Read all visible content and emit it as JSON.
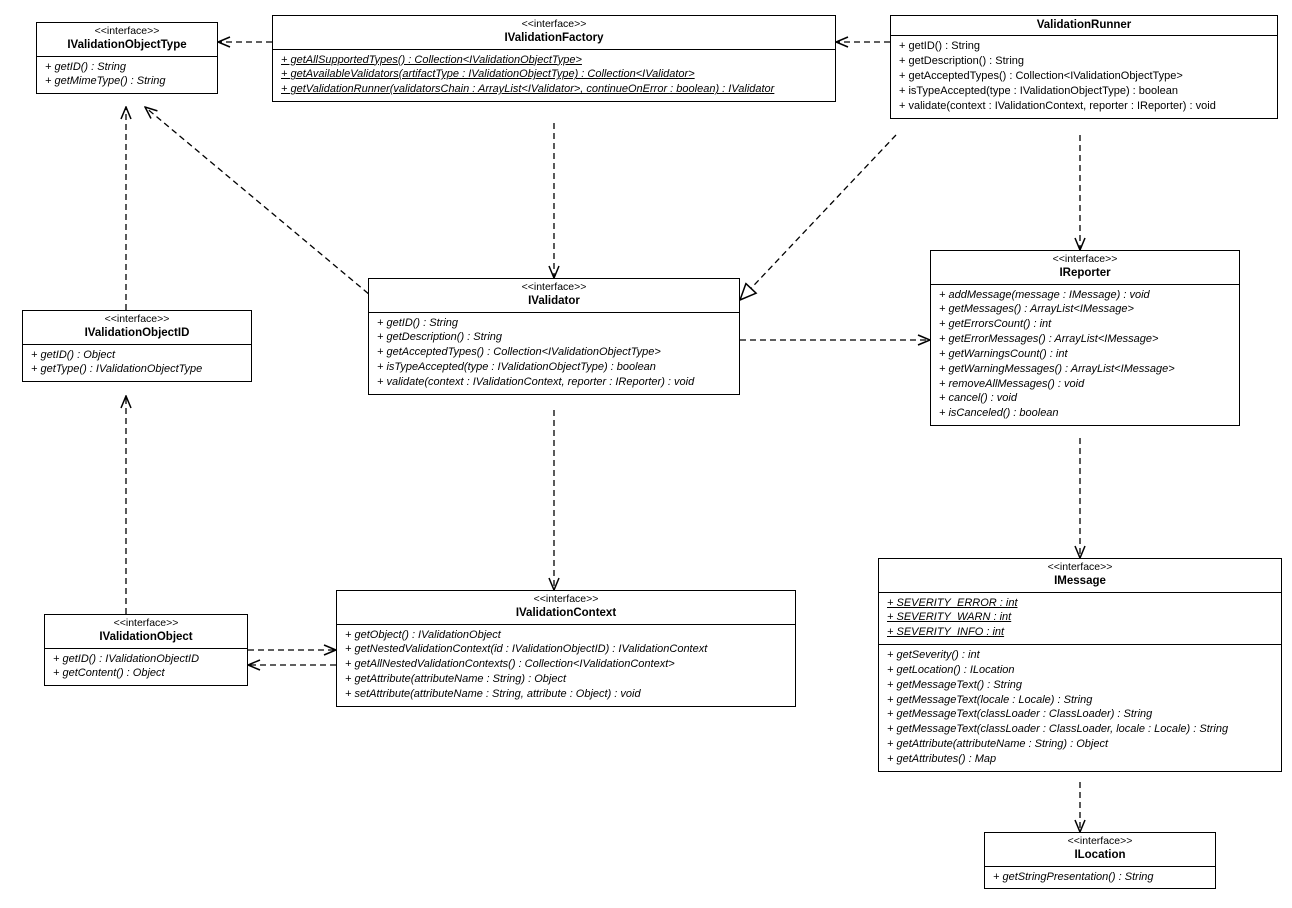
{
  "iValidationObjectType": {
    "stereo": "<<interface>>",
    "name": "IValidationObjectType",
    "ops": [
      "+ getID() : String",
      "+ getMimeType() : String"
    ]
  },
  "iValidationFactory": {
    "stereo": "<<interface>>",
    "name": "IValidationFactory",
    "ops": [
      "+ getAllSupportedTypes() : Collection<IValidationObjectType>",
      "+ getAvailableValidators(artifactType : IValidationObjectType) : Collection<IValidator>",
      "+ getValidationRunner(validatorsChain : ArrayList<IValidator>, continueOnError : boolean) : IValidator"
    ],
    "staticOps": true
  },
  "validationRunner": {
    "name": "ValidationRunner",
    "ops": [
      "+ getID() : String",
      "+ getDescription() : String",
      "+ getAcceptedTypes() : Collection<IValidationObjectType>",
      "+ isTypeAccepted(type : IValidationObjectType) : boolean",
      "+ validate(context : IValidationContext, reporter : IReporter) : void"
    ]
  },
  "iValidationObjectID": {
    "stereo": "<<interface>>",
    "name": "IValidationObjectID",
    "ops": [
      "+ getID() : Object",
      "+ getType() : IValidationObjectType"
    ]
  },
  "iValidator": {
    "stereo": "<<interface>>",
    "name": "IValidator",
    "ops": [
      "+ getID() : String",
      "+ getDescription() : String",
      "+ getAcceptedTypes() : Collection<IValidationObjectType>",
      "+ isTypeAccepted(type : IValidationObjectType) : boolean",
      "+ validate(context : IValidationContext, reporter : IReporter) : void"
    ]
  },
  "iReporter": {
    "stereo": "<<interface>>",
    "name": "IReporter",
    "ops": [
      "+ addMessage(message : IMessage) : void",
      "+ getMessages() : ArrayList<IMessage>",
      "+ getErrorsCount() : int",
      "+ getErrorMessages() : ArrayList<IMessage>",
      "+ getWarningsCount() : int",
      "+ getWarningMessages() : ArrayList<IMessage>",
      "+ removeAllMessages() : void",
      "+ cancel() : void",
      "+ isCanceled() : boolean"
    ]
  },
  "iValidationObject": {
    "stereo": "<<interface>>",
    "name": "IValidationObject",
    "ops": [
      "+ getID() : IValidationObjectID",
      "+ getContent() : Object"
    ]
  },
  "iValidationContext": {
    "stereo": "<<interface>>",
    "name": "IValidationContext",
    "ops": [
      "+ getObject() : IValidationObject",
      "+ getNestedValidationContext(id : IValidationObjectID) : IValidationContext",
      "+ getAllNestedValidationContexts() : Collection<IValidationContext>",
      "+ getAttribute(attributeName : String) : Object",
      "+ setAttribute(attributeName : String, attribute : Object) : void"
    ]
  },
  "iMessage": {
    "stereo": "<<interface>>",
    "name": "IMessage",
    "attrs": [
      "+ SEVERITY_ERROR : int",
      "+ SEVERITY_WARN : int",
      "+ SEVERITY_INFO : int"
    ],
    "ops": [
      "+ getSeverity() : int",
      "+ getLocation() : ILocation",
      "+ getMessageText() : String",
      "+ getMessageText(locale : Locale) : String",
      "+ getMessageText(classLoader : ClassLoader) : String",
      "+ getMessageText(classLoader : ClassLoader, locale : Locale) : String",
      "+ getAttribute(attributeName : String) : Object",
      "+ getAttributes() : Map"
    ]
  },
  "iLocation": {
    "stereo": "<<interface>>",
    "name": "ILocation",
    "ops": [
      "+ getStringPresentation() : String"
    ]
  }
}
